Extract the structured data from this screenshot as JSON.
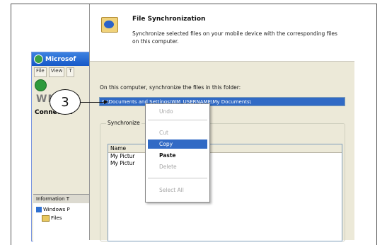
{
  "background_window": {
    "title": "Microsof",
    "menu": [
      "File",
      "View",
      "T"
    ],
    "device_name": "WM_US",
    "status": "Connected",
    "info_header": "Information T",
    "tree": [
      "Windows P",
      "Files"
    ]
  },
  "dialog": {
    "title": "File Synchronization",
    "description": "Synchronize selected files on your mobile device with the corresponding files on this computer.",
    "folder_label": "On this computer, synchronize the files in this folder:",
    "folder_path": "C:\\Documents and Settings\\WM_USERNAME\\My Documents\\",
    "group_label": "Synchronize",
    "list_header": "Name",
    "list_items": [
      "My Pictur",
      "My Pictur"
    ]
  },
  "context_menu": {
    "items": [
      {
        "label": "Undo",
        "state": "disabled"
      },
      {
        "label": "Cut",
        "state": "disabled"
      },
      {
        "label": "Copy",
        "state": "selected"
      },
      {
        "label": "Paste",
        "state": "bold"
      },
      {
        "label": "Delete",
        "state": "disabled"
      },
      {
        "label": "Select All",
        "state": "disabled"
      }
    ]
  },
  "callout": {
    "number": "3"
  },
  "colors": {
    "selection": "#316ac5",
    "dialog_bg": "#ece9d8",
    "titlebar": "#1658c8"
  }
}
